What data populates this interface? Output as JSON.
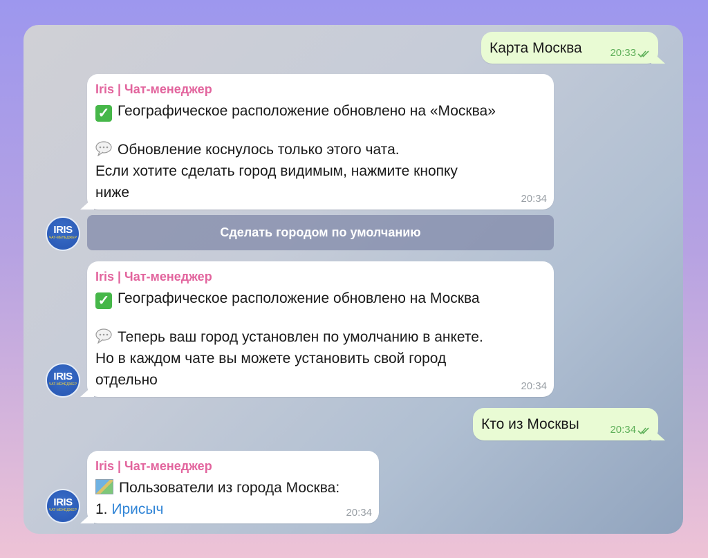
{
  "messages": [
    {
      "id": "m1",
      "direction": "out",
      "text": "Карта Москва",
      "time": "20:33",
      "read": true
    },
    {
      "id": "m2",
      "direction": "in",
      "sender": "Iris | Чат-менеджер",
      "line1": "Географическое расположение обновлено на «Москва»",
      "line2": "Обновление коснулось только этого чата.",
      "line3": "Если хотите сделать город видимым, нажмите кнопку",
      "line4": "ниже",
      "time": "20:34"
    },
    {
      "id": "m3",
      "direction": "in",
      "sender": "Iris | Чат-менеджер",
      "line1": "Географическое расположение обновлено на Москва",
      "line2": "Теперь ваш город установлен по умолчанию в анкете.",
      "line3": "Но в каждом чате вы можете установить свой город",
      "line4": "отдельно",
      "time": "20:34"
    },
    {
      "id": "m4",
      "direction": "out",
      "text": "Кто из Москвы",
      "time": "20:34",
      "read": true
    },
    {
      "id": "m5",
      "direction": "in",
      "sender": "Iris | Чат-менеджер",
      "line1": "Пользователи из города Москва:",
      "item_prefix": "1.",
      "item_link": "Ирисыч",
      "time": "20:34"
    }
  ],
  "inline_button": {
    "label": "Сделать городом по умолчанию"
  },
  "avatar": {
    "title": "IRIS",
    "subtitle": "ЧАТ-МЕНЕДЖЕР"
  },
  "icons": {
    "check": "white-heavy-check-mark-icon",
    "speech": "speech-balloon-icon",
    "map": "world-map-icon",
    "read": "double-check-icon"
  },
  "colors": {
    "sender": "#e2649d",
    "link": "#2f84d6",
    "outgoing_bubble": "#e9fbd4",
    "read_ticks": "#5fb05a"
  }
}
